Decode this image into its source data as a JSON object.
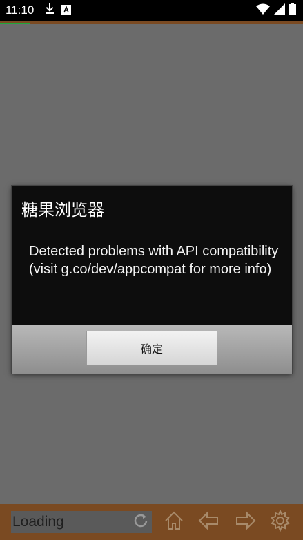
{
  "status_bar": {
    "time": "11:10",
    "icons": [
      "download-icon",
      "accessibility-icon",
      "wifi-icon",
      "signal-icon",
      "battery-icon"
    ]
  },
  "dialog": {
    "title": "糖果浏览器",
    "message_line1": "Detected problems with API compatibility",
    "message_line2": "(visit g.co/dev/appcompat for more info)",
    "ok_label": "确定"
  },
  "toolbar": {
    "url_text": "Loading",
    "buttons": [
      "refresh-icon",
      "home-icon",
      "back-icon",
      "forward-icon",
      "settings-icon"
    ]
  },
  "colors": {
    "toolbar_bg": "#7a4a22",
    "page_bg": "#6b6b6b",
    "dialog_bg": "#0d0d0d",
    "progress": "#21a63a"
  }
}
